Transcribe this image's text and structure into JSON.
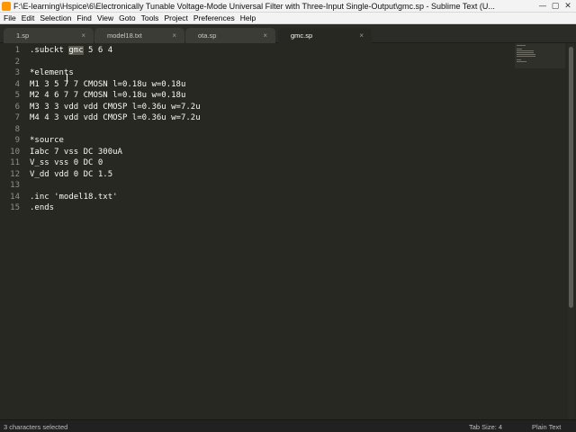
{
  "window": {
    "title": "F:\\E-learning\\Hspice\\6\\Electronically Tunable Voltage-Mode Universal Filter with Three-Input Single-Output\\gmc.sp - Sublime Text (U...",
    "minimize_glyph": "—",
    "maximize_glyph": "▢",
    "close_glyph": "✕"
  },
  "menu": {
    "items": [
      "File",
      "Edit",
      "Selection",
      "Find",
      "View",
      "Goto",
      "Tools",
      "Project",
      "Preferences",
      "Help"
    ]
  },
  "tabs": [
    {
      "label": "1.sp",
      "close": "×",
      "active": false
    },
    {
      "label": "model18.txt",
      "close": "×",
      "active": false
    },
    {
      "label": "ota.sp",
      "close": "×",
      "active": false
    },
    {
      "label": "gmc.sp",
      "close": "×",
      "active": true
    }
  ],
  "editor": {
    "lines": [
      {
        "num": "1",
        "text": ".subckt gmc 5 6 4"
      },
      {
        "num": "2",
        "text": ""
      },
      {
        "num": "3",
        "text": "*elements"
      },
      {
        "num": "4",
        "text": "M1 3 5 7 7 CMOSN l=0.18u w=0.18u"
      },
      {
        "num": "5",
        "text": "M2 4 6 7 7 CMOSN l=0.18u w=0.18u"
      },
      {
        "num": "6",
        "text": "M3 3 3 vdd vdd CMOSP l=0.36u w=7.2u"
      },
      {
        "num": "7",
        "text": "M4 4 3 vdd vdd CMOSP l=0.36u w=7.2u"
      },
      {
        "num": "8",
        "text": ""
      },
      {
        "num": "9",
        "text": "*source"
      },
      {
        "num": "10",
        "text": "Iabc 7 vss DC 300uA"
      },
      {
        "num": "11",
        "text": "V_ss vss 0 DC 0"
      },
      {
        "num": "12",
        "text": "V_dd vdd 0 DC 1.5"
      },
      {
        "num": "13",
        "text": ""
      },
      {
        "num": "14",
        "text": ".inc 'model18.txt'"
      },
      {
        "num": "15",
        "text": ".ends"
      }
    ],
    "line1_prefix": ".subckt ",
    "line1_selection": "gmc",
    "line1_suffix": " 5 6 4"
  },
  "status": {
    "selection": "3 characters selected",
    "tab_size": "Tab Size: 4",
    "syntax": "Plain Text"
  },
  "colors": {
    "editor_bg": "#272822",
    "text": "#f8f8f2",
    "line_numbers": "#8f908a",
    "selection": "#5a5a50",
    "app_icon": "#ff9800"
  }
}
